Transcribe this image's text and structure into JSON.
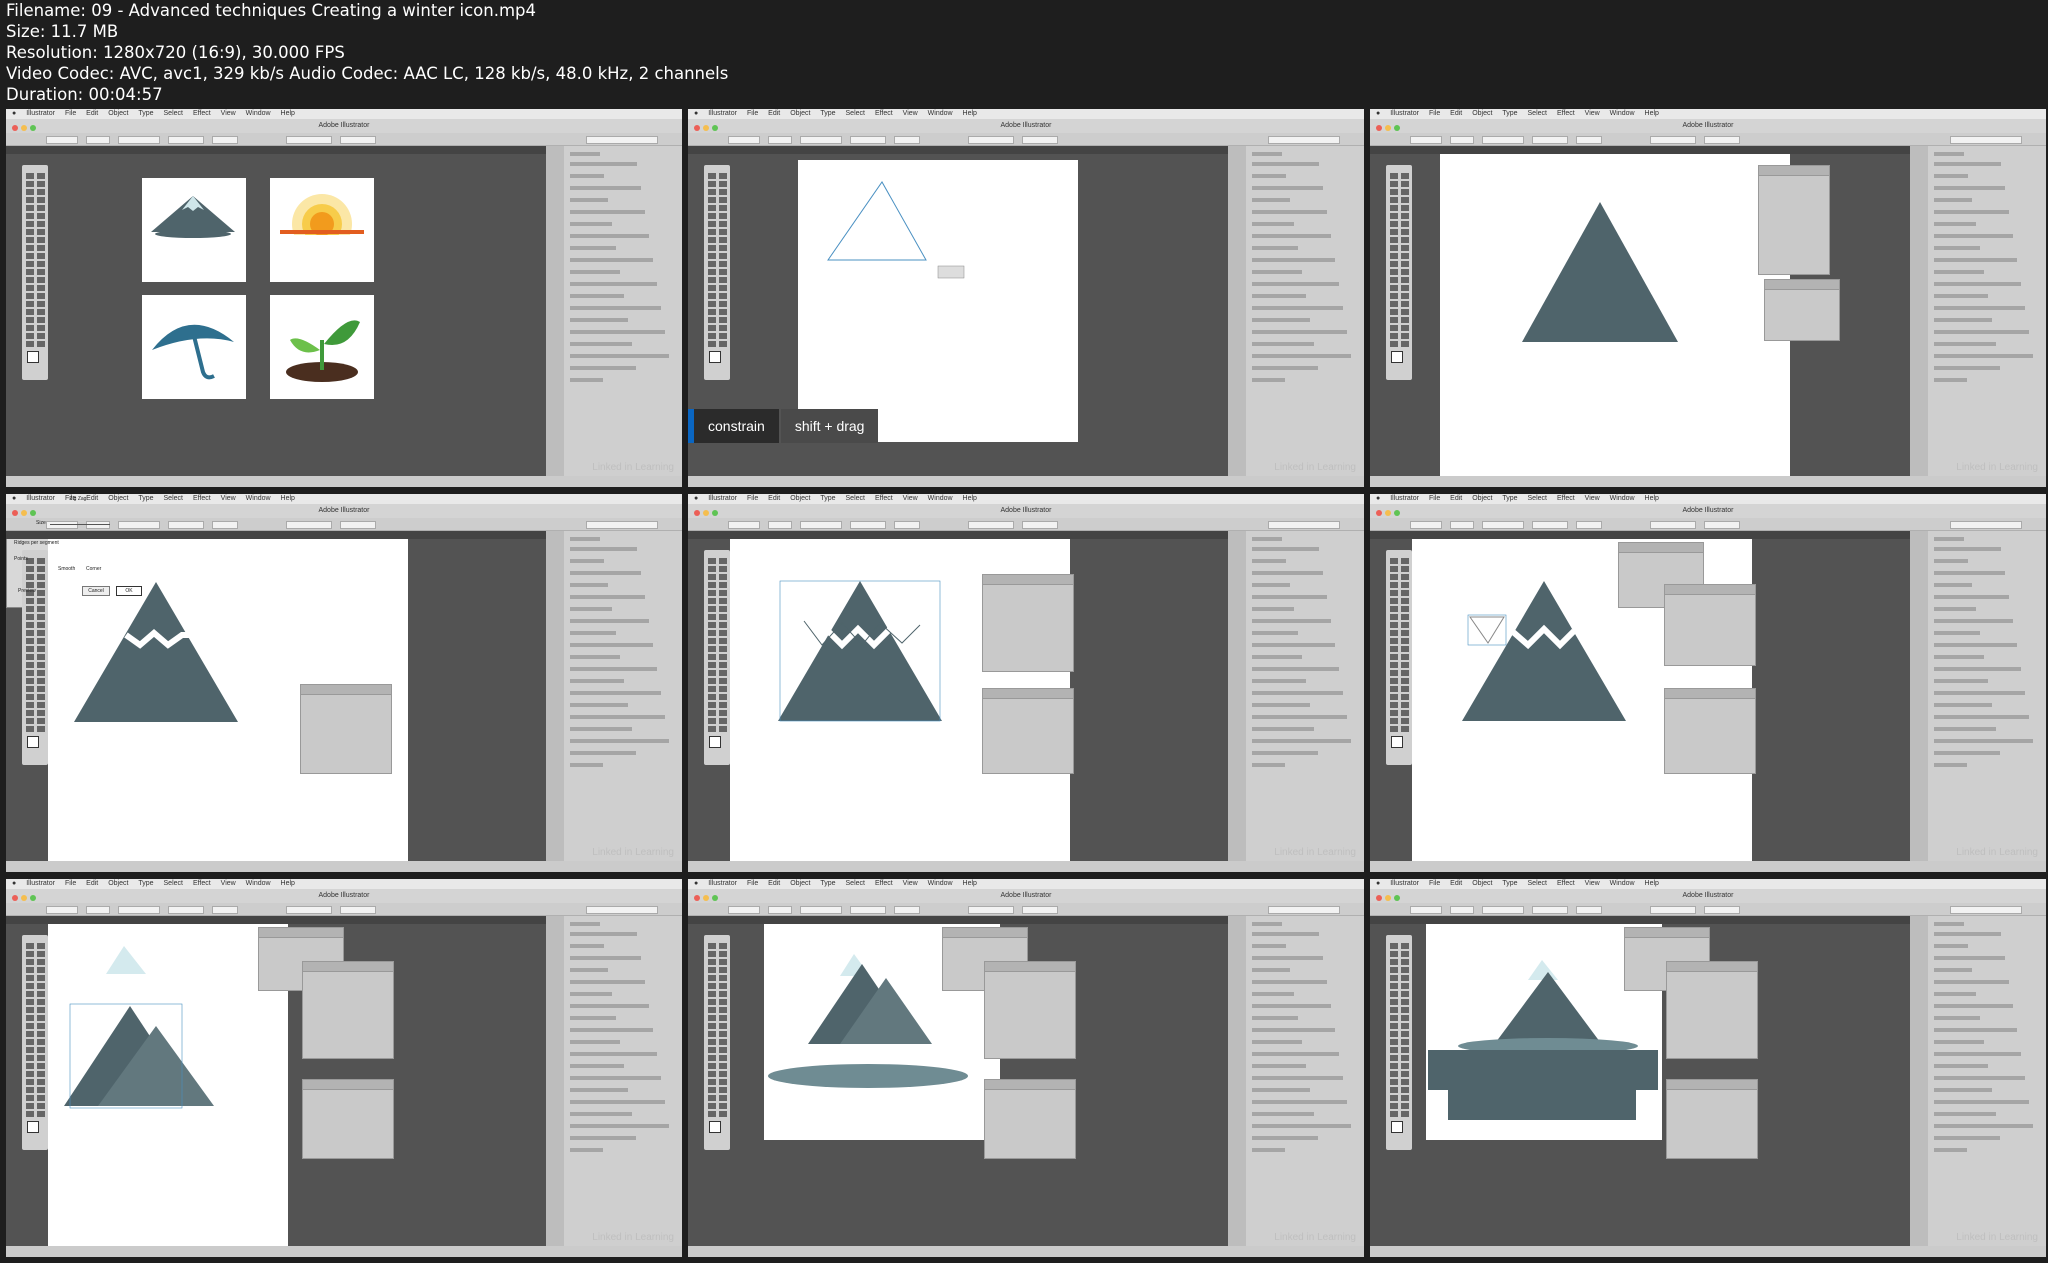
{
  "file_info": {
    "filename": "Filename: 09 - Advanced techniques Creating a winter icon.mp4",
    "size": "Size: 11.7 MB",
    "resolution": "Resolution: 1280x720 (16:9), 30.000 FPS",
    "codec": "Video Codec: AVC, avc1, 329 kb/s Audio Codec: AAC LC, 128 kb/s, 48.0 kHz, 2 channels",
    "duration": "Duration: 00:04:57"
  },
  "app": {
    "menu": [
      "Illustrator",
      "File",
      "Edit",
      "Object",
      "Type",
      "Select",
      "Effect",
      "View",
      "Window",
      "Help"
    ],
    "title": "Adobe Illustrator",
    "watermark": "Linked in Learning"
  },
  "overlay": {
    "constrain": "constrain",
    "shift_drag": "shift + drag"
  },
  "dialog": {
    "title": "Zig Zag",
    "size_label": "Size",
    "ridges_label": "Ridges per segment",
    "points_label": "Points",
    "smooth": "Smooth",
    "corner": "Corner",
    "preview": "Preview",
    "cancel": "Cancel",
    "ok": "OK"
  },
  "colors": {
    "mountain": "#4f646b",
    "snow": "#cfe6ea",
    "sun": "#f4b51e",
    "umbrella": "#2e6f8e",
    "leaf": "#3f9a3a",
    "soil": "#4a2e1f",
    "accent": "#0a66c2"
  }
}
